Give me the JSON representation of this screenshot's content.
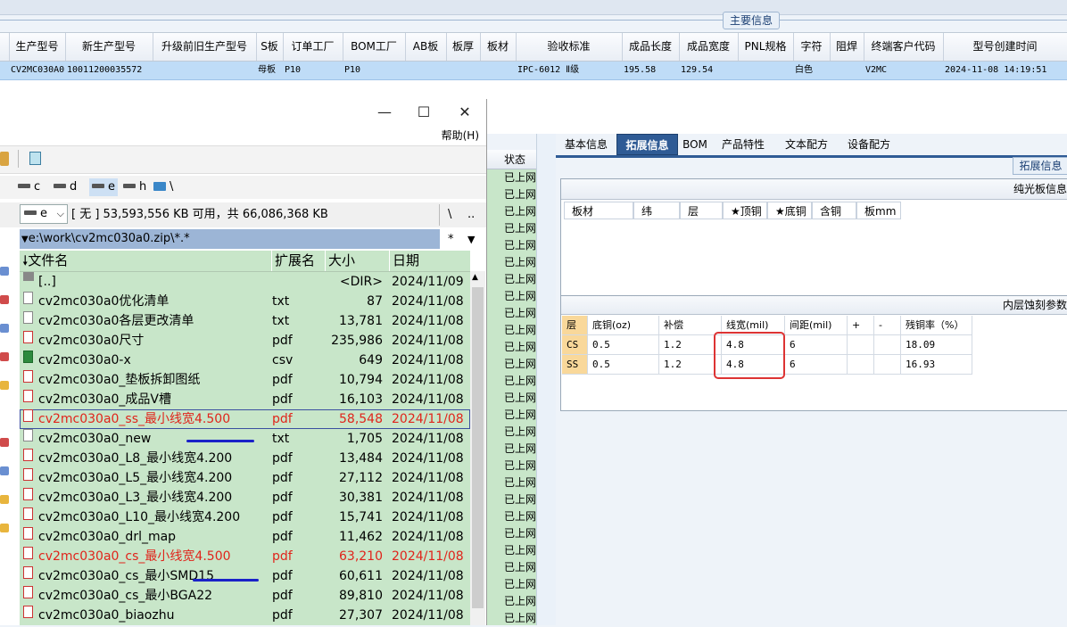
{
  "main_info": {
    "tab_label": "主要信息",
    "columns": [
      "生产型号",
      "新生产型号",
      "升级前旧生产型号",
      "S板",
      "订单工厂",
      "BOM工厂",
      "AB板",
      "板厚",
      "板材",
      "验收标准",
      "成品长度",
      "成品宽度",
      "PNL规格",
      "字符",
      "阻焊",
      "终端客户代码",
      "型号创建时间"
    ],
    "row": [
      "CV2MC030A0",
      "10011200035572",
      "",
      "母板",
      "P10",
      "P10",
      "",
      "",
      "",
      "IPC-6012 Ⅱ级",
      "195.58",
      "129.54",
      "",
      "白色",
      "",
      "V2MC",
      "2024-11-08 14:19:51"
    ]
  },
  "status_col": {
    "header": "状态",
    "cell_text": "已上网",
    "count": 27
  },
  "right_panel": {
    "tabs": [
      "基本信息",
      "拓展信息",
      "BOM",
      "产品特性",
      "文本配方",
      "设备配方"
    ],
    "active_tab": "拓展信息",
    "ext_tab_label": "拓展信息",
    "box1": {
      "title": "纯光板信息",
      "headers": [
        "板材",
        "纬",
        "层",
        "★顶铜",
        "★底铜",
        "含铜",
        "板mm"
      ]
    },
    "box2": {
      "title": "内层蚀刻参数",
      "headers": [
        "层",
        "底铜(oz)",
        "补偿",
        "线宽(mil)",
        "间距(mil)",
        "+",
        "-",
        "残铜率（%）"
      ],
      "rows": [
        [
          "CS",
          "0.5",
          "1.2",
          "4.8",
          "6",
          "",
          "",
          "18.09"
        ],
        [
          "SS",
          "0.5",
          "1.2",
          "4.8",
          "6",
          "",
          "",
          "16.93"
        ]
      ]
    }
  },
  "file_manager": {
    "window_controls": {
      "minimize": "—",
      "maximize": "☐",
      "close": "✕"
    },
    "help_menu": "帮助(H)",
    "drives": [
      "c",
      "d",
      "e",
      "h",
      "\\"
    ],
    "drive_combo": "e",
    "free_space": "[ 无 ]  53,593,556 KB 可用，共 66,086,368 KB",
    "nav_back": "\\",
    "nav_up": "..",
    "path": "e:\\work\\cv2mc030a0.zip\\*.*",
    "filter_star": "*",
    "headers": {
      "name": "🠗文件名",
      "ext": "扩展名",
      "size": "大小",
      "date": "日期"
    },
    "files": [
      {
        "name": "[..]",
        "ext": "",
        "size": "<DIR>",
        "date": "2024/11/09",
        "icon": "up",
        "highlight": false
      },
      {
        "name": "cv2mc030a0优化清单",
        "ext": "txt",
        "size": "87",
        "date": "2024/11/08",
        "icon": "txt",
        "highlight": false
      },
      {
        "name": "cv2mc030a0各层更改清单",
        "ext": "txt",
        "size": "13,781",
        "date": "2024/11/08",
        "icon": "txt",
        "highlight": false
      },
      {
        "name": "cv2mc030a0尺寸",
        "ext": "pdf",
        "size": "235,986",
        "date": "2024/11/08",
        "icon": "pdf",
        "highlight": false
      },
      {
        "name": "cv2mc030a0-x",
        "ext": "csv",
        "size": "649",
        "date": "2024/11/08",
        "icon": "csv",
        "highlight": false
      },
      {
        "name": "cv2mc030a0_垫板拆卸图纸",
        "ext": "pdf",
        "size": "10,794",
        "date": "2024/11/08",
        "icon": "pdf",
        "highlight": false
      },
      {
        "name": "cv2mc030a0_成品V槽",
        "ext": "pdf",
        "size": "16,103",
        "date": "2024/11/08",
        "icon": "pdf",
        "highlight": false
      },
      {
        "name": "cv2mc030a0_ss_最小线宽4.500",
        "ext": "pdf",
        "size": "58,548",
        "date": "2024/11/08",
        "icon": "pdf",
        "highlight": true
      },
      {
        "name": "cv2mc030a0_new",
        "ext": "txt",
        "size": "1,705",
        "date": "2024/11/08",
        "icon": "txt",
        "highlight": false
      },
      {
        "name": "cv2mc030a0_L8_最小线宽4.200",
        "ext": "pdf",
        "size": "13,484",
        "date": "2024/11/08",
        "icon": "pdf",
        "highlight": false
      },
      {
        "name": "cv2mc030a0_L5_最小线宽4.200",
        "ext": "pdf",
        "size": "27,112",
        "date": "2024/11/08",
        "icon": "pdf",
        "highlight": false
      },
      {
        "name": "cv2mc030a0_L3_最小线宽4.200",
        "ext": "pdf",
        "size": "30,381",
        "date": "2024/11/08",
        "icon": "pdf",
        "highlight": false
      },
      {
        "name": "cv2mc030a0_L10_最小线宽4.200",
        "ext": "pdf",
        "size": "15,741",
        "date": "2024/11/08",
        "icon": "pdf",
        "highlight": false
      },
      {
        "name": "cv2mc030a0_drl_map",
        "ext": "pdf",
        "size": "11,462",
        "date": "2024/11/08",
        "icon": "pdf",
        "highlight": false
      },
      {
        "name": "cv2mc030a0_cs_最小线宽4.500",
        "ext": "pdf",
        "size": "63,210",
        "date": "2024/11/08",
        "icon": "pdf",
        "highlight": true
      },
      {
        "name": "cv2mc030a0_cs_最小SMD15",
        "ext": "pdf",
        "size": "60,611",
        "date": "2024/11/08",
        "icon": "pdf",
        "highlight": false
      },
      {
        "name": "cv2mc030a0_cs_最小BGA22",
        "ext": "pdf",
        "size": "89,810",
        "date": "2024/11/08",
        "icon": "pdf",
        "highlight": false
      },
      {
        "name": "cv2mc030a0_biaozhu",
        "ext": "pdf",
        "size": "27,307",
        "date": "2024/11/08",
        "icon": "pdf",
        "highlight": false
      }
    ]
  },
  "colors": {
    "highlight_red": "#e0241b",
    "list_green": "#c8e6c9",
    "selected_row_blue": "#bfdcf7",
    "active_tab_blue": "#2f5b95",
    "annotation_red": "#dd3333",
    "annotation_blue": "#1a22c8"
  }
}
